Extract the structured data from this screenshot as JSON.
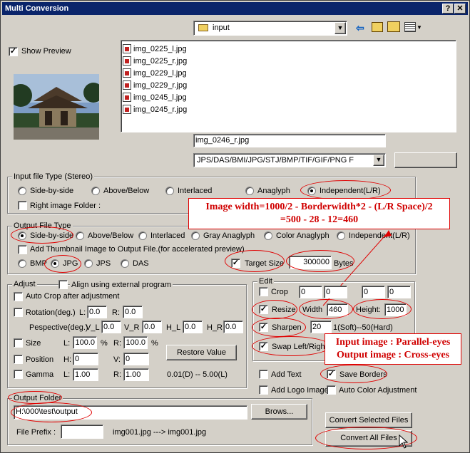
{
  "window": {
    "title": "Multi Conversion",
    "help_label": "?",
    "close_label": "✕"
  },
  "folder_combo": {
    "value": "input"
  },
  "preview": {
    "label": "Show Preview",
    "checked": true
  },
  "files": [
    "img_0225_l.jpg",
    "img_0225_r.jpg",
    "img_0229_l.jpg",
    "img_0229_r.jpg",
    "img_0245_l.jpg",
    "img_0245_r.jpg"
  ],
  "filename_input": "img_0246_r.jpg",
  "filter_combo": "JPS/DAS/BMI/JPG/STJ/BMP/TIF/GIF/PNG F",
  "input_type": {
    "title": "Input file Type (Stereo)",
    "side_by_side": "Side-by-side",
    "above_below": "Above/Below",
    "interlaced": "Interlaced",
    "anaglyph": "Anaglyph",
    "independent": "Independent(L/R)",
    "right_folder": "Right image Folder :"
  },
  "output_type": {
    "title": "Output File Type",
    "side_by_side": "Side-by-side",
    "above_below": "Above/Below",
    "interlaced": "Interlaced",
    "gray_anaglyph": "Gray Anaglyph",
    "color_anaglyph": "Color Anaglyph",
    "independent": "Independent(L/R)",
    "thumbnail": "Add Thumbnail Image to Output File.(for accelerated preview)",
    "bmp": "BMP",
    "jpg": "JPG",
    "jps": "JPS",
    "das": "DAS",
    "target_size": "Target Size",
    "target_value": "300000",
    "bytes": "Bytes"
  },
  "annotation_formula": {
    "line1": "Image width=1000/2 - Borderwidth*2 - (L/R Space)/2",
    "line2": "=500 - 28 - 12=460"
  },
  "adjust": {
    "title": "Adjust",
    "external": "Align using external program",
    "auto_crop": "Auto Crop after adjustment",
    "rotation": "Rotation(deg.)",
    "rot_l_label": "L:",
    "rot_l": "0.0",
    "rot_r_label": "R:",
    "rot_r": "0.0",
    "perspective": "Pespective(deg.)",
    "vl_label": "V_L",
    "vl": "0.0",
    "vr_label": "V_R",
    "vr": "0.0",
    "hl_label": "H_L",
    "hl": "0.0",
    "hr_label": "H_R",
    "hr": "0.0",
    "size": "Size",
    "size_l_label": "L:",
    "size_l": "100.0",
    "size_l_unit": "%",
    "size_r_label": "R:",
    "size_r": "100.0",
    "size_r_unit": "%",
    "position": "Position",
    "pos_h_label": "H:",
    "pos_h": "0",
    "pos_v_label": "V:",
    "pos_v": "0",
    "restore": "Restore Value",
    "gamma": "Gamma",
    "gam_l_label": "L:",
    "gam_l": "1.00",
    "gam_r_label": "R:",
    "gam_r": "1.00",
    "gamma_range": "0.01(D) -- 5.00(L)"
  },
  "edit": {
    "title": "Edit",
    "crop": "Crop",
    "crop_vals": [
      "0",
      "0",
      "0",
      "0"
    ],
    "resize": "Resize",
    "width_label": "Width",
    "width_val": "460",
    "height_label": "Height:",
    "height_val": "1000",
    "sharpen": "Sharpen",
    "sharpen_val": "20",
    "sharpen_hint": "1(Soft)--50(Hard)",
    "swap": "Swap Left/Right"
  },
  "annotation_eyes": {
    "line1": "Input image : Parallel-eyes",
    "line2": "Output image : Cross-eyes"
  },
  "extras": {
    "add_text": "Add Text",
    "save_borders": "Save Borders",
    "add_logo": "Add Logo Image",
    "auto_color": "Auto Color Adjustment"
  },
  "output_folder": {
    "title": "Output Folder",
    "path": "H:\\000\\test\\output",
    "browse": "Brows...",
    "prefix_label": "File Prefix :",
    "prefix_value": "",
    "example": "img001.jpg ---> img001.jpg"
  },
  "actions": {
    "convert_selected": "Convert Selected Files",
    "convert_all": "Convert All Files"
  },
  "colors": {
    "title_bar": "#0a246a",
    "face": "#d4d0c8",
    "annotation_red": "#e00000"
  }
}
